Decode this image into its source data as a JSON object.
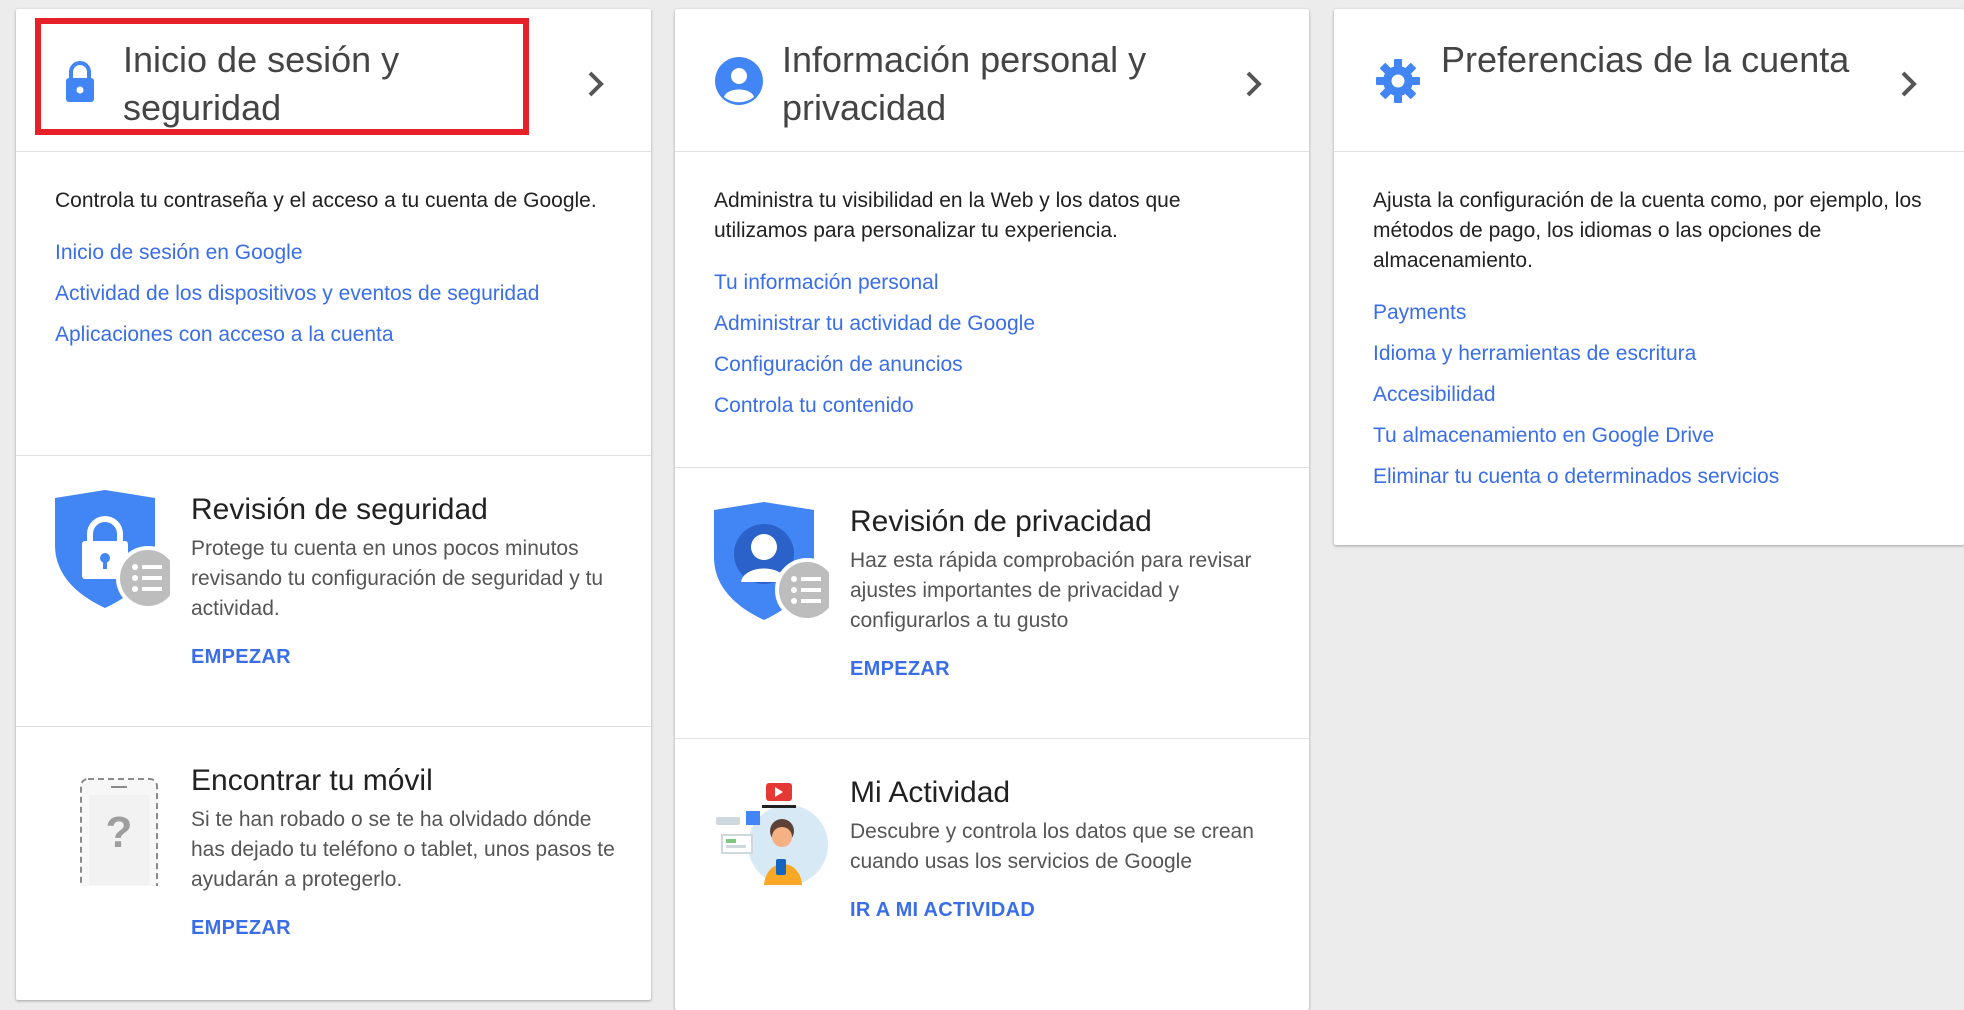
{
  "colors": {
    "link": "#3a6ee8",
    "accent_blue": "#4285f4",
    "highlight": "#e8202a"
  },
  "columns": [
    {
      "icon": "lock-icon",
      "title": "Inicio de sesión y seguridad",
      "description": "Controla tu contraseña y el acceso a tu cuenta de Google.",
      "links": [
        "Inicio de sesión en Google",
        "Actividad de los dispositivos y eventos de seguridad",
        "Aplicaciones con acceso a la cuenta"
      ],
      "features": [
        {
          "icon": "security-shield-icon",
          "title": "Revisión de seguridad",
          "description": "Protege tu cuenta en unos pocos minutos revisando tu configuración de seguridad y tu actividad.",
          "action": "EMPEZAR"
        },
        {
          "icon": "phone-question-icon",
          "title": "Encontrar tu móvil",
          "description": "Si te han robado o se te ha olvidado dónde has dejado tu teléfono o tablet, unos pasos te ayudarán a protegerlo.",
          "action": "EMPEZAR"
        }
      ]
    },
    {
      "icon": "person-icon",
      "title": "Información personal y privacidad",
      "description": "Administra tu visibilidad en la Web y los datos que utilizamos para personalizar tu experiencia.",
      "links": [
        "Tu información personal",
        "Administrar tu actividad de Google",
        "Configuración de anuncios",
        "Controla tu contenido"
      ],
      "features": [
        {
          "icon": "privacy-shield-icon",
          "title": "Revisión de privacidad",
          "description": "Haz esta rápida comprobación para revisar ajustes importantes de privacidad y configurarlos a tu gusto",
          "action": "EMPEZAR"
        },
        {
          "icon": "my-activity-illustration-icon",
          "title": "Mi Actividad",
          "description": "Descubre y controla los datos que se crean cuando usas los servicios de Google",
          "action": "IR A MI ACTIVIDAD"
        }
      ]
    },
    {
      "icon": "gear-icon",
      "title": "Preferencias de la cuenta",
      "description": "Ajusta la configuración de la cuenta como, por ejemplo, los métodos de pago, los idiomas o las opciones de almacenamiento.",
      "links": [
        "Payments",
        "Idioma y herramientas de escritura",
        "Accesibilidad",
        "Tu almacenamiento en Google Drive",
        "Eliminar tu cuenta o determinados servicios"
      ],
      "features": []
    }
  ]
}
